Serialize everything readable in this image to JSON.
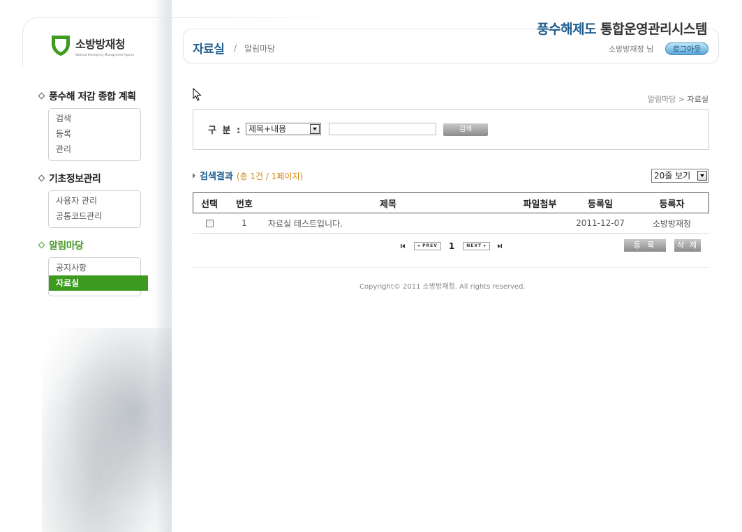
{
  "org": {
    "logo_text": "소방방재청",
    "logo_sub": "National Emergency Management Agency"
  },
  "system_title": {
    "highlight": "풍수해제도",
    "rest": " 통합운영관리시스템"
  },
  "page": {
    "title": "자료실",
    "separator": "/",
    "parent": "알림마당"
  },
  "user": {
    "name": "소방방재청 님",
    "logout_label": "로그아웃"
  },
  "breadcrumb": {
    "parent": "알림마당",
    "sep": " > ",
    "current": "자료실"
  },
  "sidebar": {
    "sections": [
      {
        "title": "풍수해 저감 종합 계획",
        "items": [
          "검색",
          "등록",
          "관리"
        ]
      },
      {
        "title": "기초정보관리",
        "items": [
          "사용자 관리",
          "공통코드관리"
        ]
      },
      {
        "title": "알림마당",
        "items": [
          "공지사항",
          "자료실"
        ],
        "active_item": "자료실"
      }
    ]
  },
  "search": {
    "label": "구 분 :",
    "select_value": "제목+내용",
    "input_value": "",
    "button_label": "검색"
  },
  "results": {
    "title": "검색결과",
    "count_text": "(총 1건 / 1페이지)",
    "per_page": "20줄 보기"
  },
  "table": {
    "columns": [
      "선택",
      "번호",
      "제목",
      "파일첨부",
      "등록일",
      "등록자"
    ],
    "rows": [
      {
        "no": "1",
        "title": "자료실 테스트입니다.",
        "file": "",
        "date": "2011-12-07",
        "author": "소방방재청"
      }
    ]
  },
  "paging": {
    "prev_label": "◂ PREV",
    "next_label": "NEXT ▸",
    "current": "1"
  },
  "actions": {
    "register": "등 록",
    "delete": "삭 제"
  },
  "footer": {
    "copyright": "Copyright© 2011 소방방재청. All rights reserved."
  },
  "colors": {
    "accent_blue": "#1e5f8f",
    "menu_active_green": "#3c9a1e",
    "count_orange": "#d68a14"
  }
}
